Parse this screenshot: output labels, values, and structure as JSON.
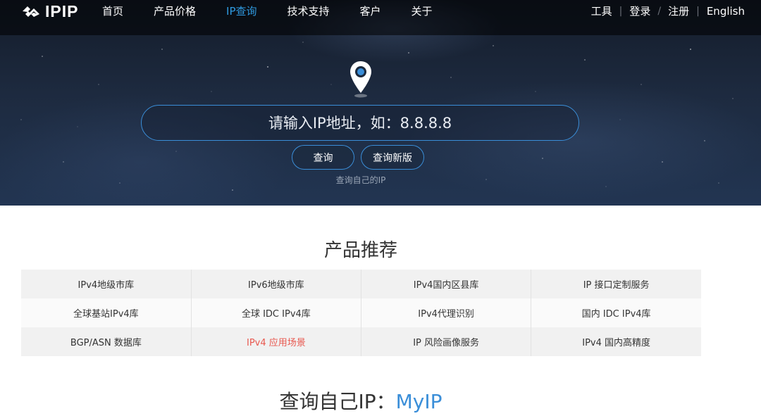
{
  "header": {
    "logo_text": "IPIP",
    "nav": [
      {
        "label": "首页",
        "active": false
      },
      {
        "label": "产品价格",
        "active": false
      },
      {
        "label": "IP查询",
        "active": true
      },
      {
        "label": "技术支持",
        "active": false
      },
      {
        "label": "客户",
        "active": false
      },
      {
        "label": "关于",
        "active": false
      }
    ],
    "right": {
      "tools": "工具",
      "login": "登录",
      "separator": "/",
      "register": "注册",
      "english": "English"
    }
  },
  "search": {
    "placeholder": "请输入IP地址，如：8.8.8.8",
    "value": "",
    "query_button": "查询",
    "query_new_button": "查询新版",
    "my_ip_link": "查询自己的IP"
  },
  "products": {
    "title": "产品推荐",
    "rows": [
      [
        "IPv4地级市库",
        "IPv6地级市库",
        "IPv4国内区县库",
        "IP 接口定制服务"
      ],
      [
        "全球基站IPv4库",
        "全球 IDC IPv4库",
        "IPv4代理识别",
        "国内 IDC IPv4库"
      ],
      [
        "BGP/ASN 数据库",
        "IPv4 应用场景",
        "IP 风险画像服务",
        "IPv4 国内高精度"
      ]
    ],
    "highlight_color": "#e8584f"
  },
  "myip": {
    "title_prefix": "查询自己IP：",
    "title_link": "MyIP"
  },
  "colors": {
    "accent": "#2f9ae0",
    "button_border": "#3a8ed8",
    "highlight": "#e8584f"
  },
  "icons": {
    "logo": "ipip-logo-icon",
    "location": "map-pin-icon"
  }
}
